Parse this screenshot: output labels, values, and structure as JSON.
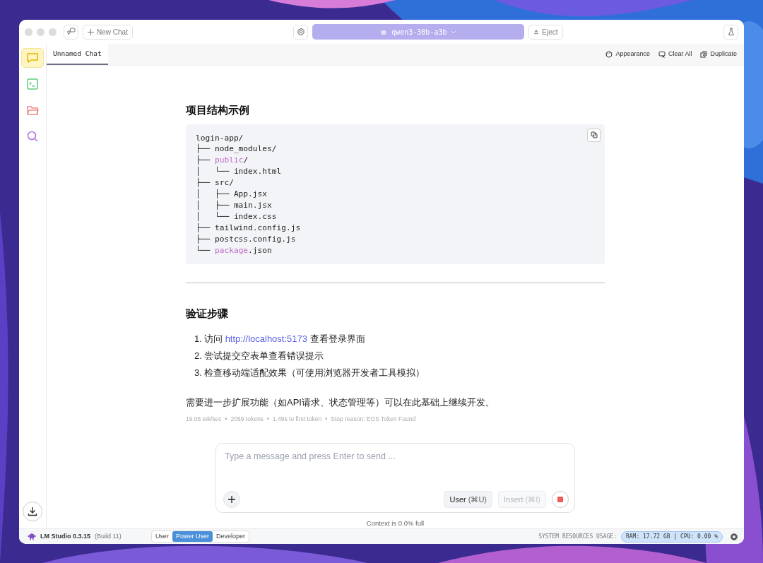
{
  "toolbar": {
    "new_chat": "New Chat",
    "model": "qwen3-30b-a3b",
    "eject": "Eject"
  },
  "sidebar": {
    "items": [
      {
        "kind": "chat",
        "selected": true
      },
      {
        "kind": "terminal",
        "selected": false
      },
      {
        "kind": "folder",
        "selected": false
      },
      {
        "kind": "search",
        "selected": false
      }
    ]
  },
  "tabs": [
    {
      "label": "Unnamed Chat",
      "selected": true
    }
  ],
  "tab_actions": [
    {
      "kind": "palette",
      "label": "Appearance"
    },
    {
      "kind": "clear",
      "label": "Clear All"
    },
    {
      "kind": "duplicate",
      "label": "Duplicate"
    }
  ],
  "message": {
    "heading_1": "项目结构示例",
    "code_lines": [
      [
        {
          "t": "login-app/",
          "hl": false
        }
      ],
      [
        {
          "t": "├── node_modules/",
          "hl": false
        }
      ],
      [
        {
          "t": "├── ",
          "hl": false
        },
        {
          "t": "public",
          "hl": true
        },
        {
          "t": "/",
          "hl": false
        }
      ],
      [
        {
          "t": "│   └── index.html",
          "hl": false
        }
      ],
      [
        {
          "t": "├── src/",
          "hl": false
        }
      ],
      [
        {
          "t": "│   ├── App.jsx",
          "hl": false
        }
      ],
      [
        {
          "t": "│   ├── main.jsx",
          "hl": false
        }
      ],
      [
        {
          "t": "│   └── index.css",
          "hl": false
        }
      ],
      [
        {
          "t": "├── tailwind.config.js",
          "hl": false
        }
      ],
      [
        {
          "t": "├── postcss.config.js",
          "hl": false
        }
      ],
      [
        {
          "t": "└── ",
          "hl": false
        },
        {
          "t": "package",
          "hl": true
        },
        {
          "t": ".json",
          "hl": false
        }
      ]
    ],
    "heading_2": "验证步骤",
    "steps": [
      {
        "number": "1.",
        "before": "访问 ",
        "link": "http://localhost:5173",
        "after": " 查看登录界面"
      },
      {
        "number": "2.",
        "before": "尝试提交空表单查看错误提示"
      },
      {
        "number": "3.",
        "before": "检查移动端适配效果（可使用浏览器开发者工具模拟）"
      }
    ],
    "paragraph": "需要进一步扩展功能（如API请求、状态管理等）可以在此基础上继续开发。",
    "stats_separator": "•",
    "stats": [
      "19.06 tok/sec",
      "2059 tokens",
      "1.49s to first token",
      "Stop reason: EOS Token Found"
    ]
  },
  "composer": {
    "placeholder": "Type a message and press Enter to send ...",
    "role_button": {
      "label": "User",
      "shortcut": "(⌘U)"
    },
    "insert_button": {
      "label": "Insert",
      "shortcut": "(⌘I)",
      "disabled": true
    },
    "context": "Context is 0.0% full"
  },
  "status_bar": {
    "app": "LM Studio 0.3.15",
    "build": "(Build 11)",
    "modes": [
      {
        "label": "User",
        "selected": false
      },
      {
        "label": "Power User",
        "selected": true
      },
      {
        "label": "Developer",
        "selected": false
      }
    ],
    "resources_label": "SYSTEM RESOURCES USAGE:",
    "resources": "RAM: 17.72 GB | CPU: 0.00 %"
  }
}
